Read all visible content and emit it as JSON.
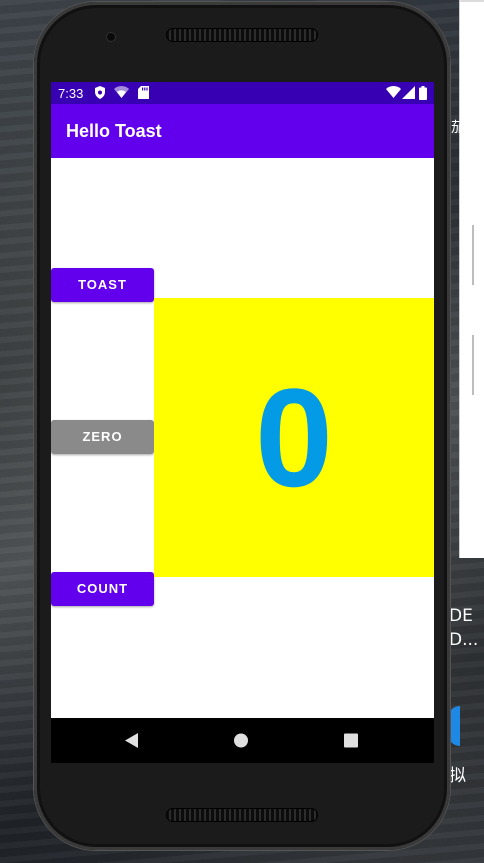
{
  "status_bar": {
    "time": "7:33",
    "icons": [
      "shield-icon",
      "wifi-icon",
      "sd-card-icon",
      "wifi-signal-icon",
      "cell-signal-icon",
      "battery-icon"
    ]
  },
  "app_bar": {
    "title": "Hello Toast",
    "color": "#6200ee"
  },
  "buttons": {
    "toast_label": "TOAST",
    "zero_label": "ZERO",
    "count_label": "COUNT"
  },
  "counter": {
    "value": "0",
    "background": "#ffff00",
    "text_color": "#039be5"
  },
  "nav_bar": {
    "icons": [
      "back-icon",
      "home-icon",
      "recents-icon"
    ]
  },
  "desktop": {
    "side_text_1": "DE",
    "side_text_2": "D...",
    "side_text_3": "拟",
    "side_text_4": "茄"
  },
  "colors": {
    "status_bar": "#3700b3",
    "primary": "#6200ee",
    "disabled_button": "#8a8a8a"
  }
}
